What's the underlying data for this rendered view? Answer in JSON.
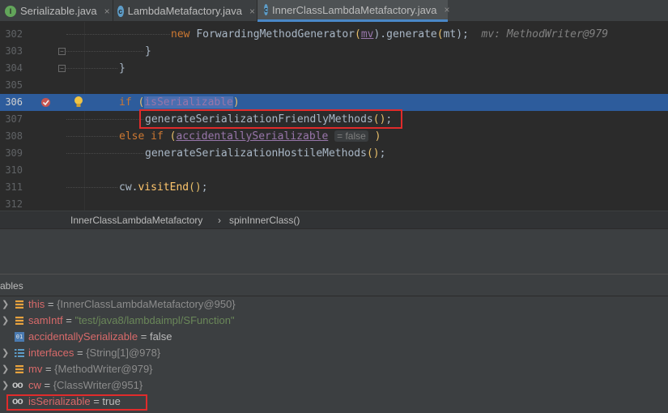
{
  "tabs": [
    {
      "label": "Serializable.java",
      "icon": "interface-icon",
      "icon_letter": "I",
      "active": false
    },
    {
      "label": "LambdaMetafactory.java",
      "icon": "class-icon",
      "icon_letter": "c",
      "active": false
    },
    {
      "label": "InnerClassLambdaMetafactory.java",
      "icon": "class-icon",
      "icon_letter": "c",
      "active": true
    }
  ],
  "tab_close_glyph": "×",
  "editor": {
    "lines": [
      {
        "num": "302"
      },
      {
        "num": "303"
      },
      {
        "num": "304"
      },
      {
        "num": "305"
      },
      {
        "num": "306"
      },
      {
        "num": "307"
      },
      {
        "num": "308"
      },
      {
        "num": "309"
      },
      {
        "num": "310"
      },
      {
        "num": "311"
      },
      {
        "num": "312"
      }
    ],
    "code": {
      "l302_new": "new",
      "l302_call": "ForwardingMethodGenerator",
      "l302_open": "(",
      "l302_arg": "mv",
      "l302_mid": ").",
      "l302_gen": "generate",
      "l302_open2": "(",
      "l302_arg2": "mt",
      "l302_end": ");",
      "l302_hint": "mv: MethodWriter@979",
      "l303": "}",
      "l304": "}",
      "l306_if": "if",
      "l306_open": "(",
      "l306_var": "isSerializable",
      "l306_close": ")",
      "l307_call": "generateSerializationFriendlyMethods",
      "l307_paren": "()",
      "l307_semi": ";",
      "l308_else": "else if",
      "l308_open": "(",
      "l308_var": "accidentallySerializable",
      "l308_hint": "= false",
      "l308_close": ")",
      "l309_call": "generateSerializationHostileMethods",
      "l309_paren": "()",
      "l309_semi": ";",
      "l311_obj": "cw.",
      "l311_call": "visitEnd",
      "l311_paren": "()",
      "l311_semi": ";"
    }
  },
  "breadcrumb": {
    "class": "InnerClassLambdaMetafactory",
    "separator": "›",
    "method": "spinInnerClass()"
  },
  "variables": {
    "header": "ables",
    "items": [
      {
        "name": "this",
        "eq": " = ",
        "value": "{InnerClassLambdaMetafactory@950}",
        "icon": "object-field-icon",
        "expandable": true
      },
      {
        "name": "samIntf",
        "eq": " = ",
        "value": "\"test/java8/lambdaimpl/SFunction\"",
        "icon": "object-field-icon",
        "expandable": true
      },
      {
        "name": "accidentallySerializable",
        "eq": " = ",
        "value": "false",
        "icon": "boolean-field-icon",
        "icon_text": "01",
        "expandable": false
      },
      {
        "name": "interfaces",
        "eq": " = ",
        "value": "{String[1]@978}",
        "icon": "array-field-icon",
        "expandable": true
      },
      {
        "name": "mv",
        "eq": " = ",
        "value": "{MethodWriter@979}",
        "icon": "object-field-icon",
        "expandable": true
      },
      {
        "name": "cw",
        "eq": " = ",
        "value": "{ClassWriter@951}",
        "icon": "watch-icon",
        "icon_text": "oo",
        "expandable": true
      },
      {
        "name": "isSerializable",
        "eq": " = ",
        "value": "true",
        "icon": "watch-icon",
        "icon_text": "oo",
        "expandable": false
      }
    ]
  },
  "colors": {
    "selection": "#2d5c9c",
    "highlight_box": "#e02b2b",
    "editor_bg": "#2b2b2b",
    "panel_bg": "#3c3f41"
  }
}
